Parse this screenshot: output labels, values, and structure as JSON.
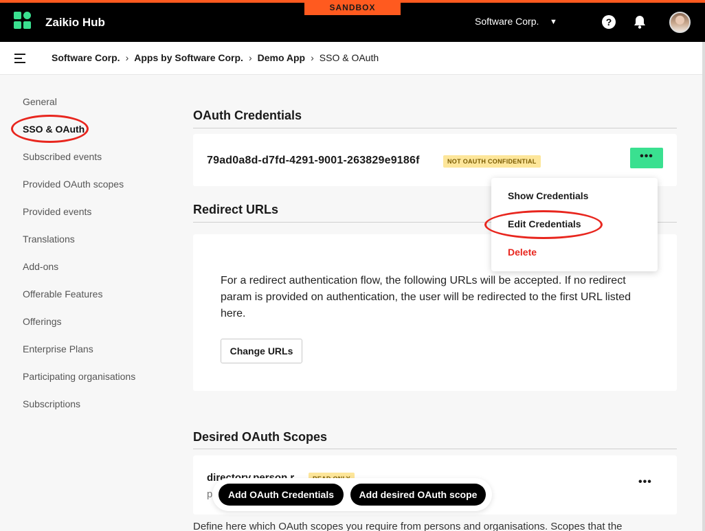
{
  "header": {
    "brand": "Zaikio Hub",
    "sandbox_label": "SANDBOX",
    "org_name": "Software Corp.",
    "help_glyph": "?",
    "icons": [
      "logo-icon",
      "chevron-down-icon",
      "help-icon",
      "bell-icon",
      "avatar"
    ]
  },
  "breadcrumb": {
    "items": [
      "Software Corp.",
      "Apps by Software Corp.",
      "Demo App",
      "SSO & OAuth"
    ],
    "separator": "›"
  },
  "sidebar": {
    "items": [
      {
        "label": "General"
      },
      {
        "label": "SSO & OAuth",
        "active": true
      },
      {
        "label": "Subscribed events"
      },
      {
        "label": "Provided OAuth scopes"
      },
      {
        "label": "Provided events"
      },
      {
        "label": "Translations"
      },
      {
        "label": "Add-ons"
      },
      {
        "label": "Offerable Features"
      },
      {
        "label": "Offerings"
      },
      {
        "label": "Enterprise Plans"
      },
      {
        "label": "Participating organisations"
      },
      {
        "label": "Subscriptions"
      }
    ]
  },
  "oauth": {
    "title": "OAuth Credentials",
    "client_id": "79ad0a8d-d7fd-4291-9001-263829e9186f",
    "tag": "NOT OAUTH CONFIDENTIAL",
    "more": "•••"
  },
  "menu": {
    "items": [
      {
        "label": "Show Credentials"
      },
      {
        "label": "Edit Credentials"
      },
      {
        "label": "Delete",
        "danger": true
      }
    ]
  },
  "redirect": {
    "title": "Redirect URLs",
    "description": "For a redirect authentication flow, the following URLs will be accepted. If no redirect param is provided on authentication, the user will be redirected to the first URL listed here.",
    "button": "Change URLs"
  },
  "scopes": {
    "title": "Desired OAuth Scopes",
    "name": "directory.person.r",
    "tag": "READ ONLY",
    "sub": "p",
    "more": "•••",
    "footer_text": "Define here which OAuth scopes you require from persons and organisations. Scopes that the"
  },
  "actions": {
    "add_credentials": "Add OAuth Credentials",
    "add_scope": "Add desired OAuth scope"
  },
  "colors": {
    "accent_green": "#3ae090",
    "sandbox_orange": "#ff5a1f",
    "annotation_red": "#e8261e",
    "tag_yellow": "#fde69a"
  }
}
